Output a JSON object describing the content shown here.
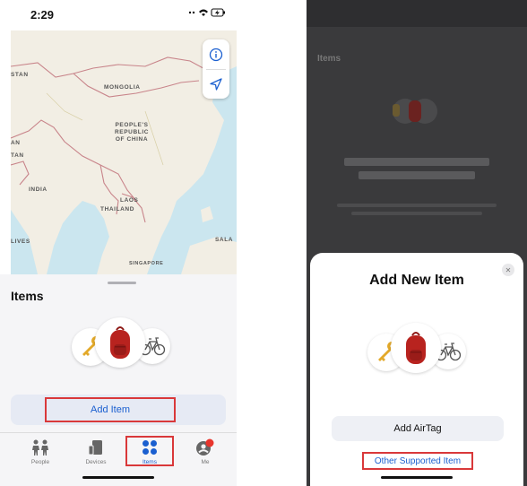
{
  "left_phone": {
    "status_time": "2:29",
    "map_labels": {
      "stan": "STAN",
      "mongolia": "MONGOLIA",
      "china": "PEOPLE'S\nREPUBLIC\nOF CHINA",
      "tan": "TAN",
      "an": "AN",
      "india": "INDIA",
      "laos": "LAOS",
      "thailand": "THAILAND",
      "sala": "SALA",
      "lives": "LIVES",
      "singapore": "SINGAPORE"
    },
    "sheet_title": "Items",
    "add_item_label": "Add Item",
    "tabs": [
      {
        "label": "People",
        "icon": "people-icon"
      },
      {
        "label": "Devices",
        "icon": "devices-icon"
      },
      {
        "label": "Items",
        "icon": "items-icon"
      },
      {
        "label": "Me",
        "icon": "me-icon"
      }
    ],
    "active_tab": "Items"
  },
  "right_phone": {
    "background_title": "Items",
    "modal_title": "Add New Item",
    "add_airtag_label": "Add AirTag",
    "other_item_label": "Other Supported Item"
  },
  "colors": {
    "accent": "#1a5fd0",
    "highlight_box": "#d9383a",
    "map_water": "#cbe6ef",
    "map_land": "#f2eee4",
    "backpack": "#b8231f"
  }
}
